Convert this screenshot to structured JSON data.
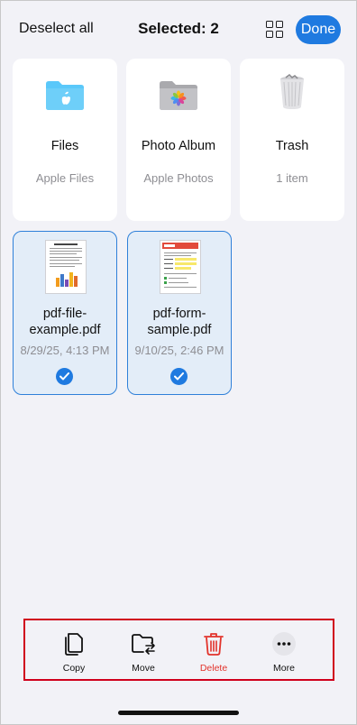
{
  "header": {
    "deselect_label": "Deselect all",
    "title": "Selected: 2",
    "grid_icon": "grid-icon",
    "done_label": "Done"
  },
  "colors": {
    "accent": "#1f7ae0",
    "selected_bg": "#e3edf8",
    "delete_red": "#e2332b",
    "highlight_box": "#d0001c"
  },
  "locations": [
    {
      "name": "Files",
      "subtitle": "Apple Files",
      "icon": "folder-icon"
    },
    {
      "name": "Photo Album",
      "subtitle": "Apple Photos",
      "icon": "photos-icon"
    },
    {
      "name": "Trash",
      "subtitle": "1 item",
      "icon": "trash-bin-icon"
    }
  ],
  "files": [
    {
      "name": "pdf-file-\nexample.pdf",
      "date": "8/29/25, 4:13 PM",
      "selected": true,
      "icon": "pdf-thumbnail-icon"
    },
    {
      "name": "pdf-form-\nsample.pdf",
      "date": "9/10/25, 2:46 PM",
      "selected": true,
      "icon": "pdf-thumbnail-icon"
    }
  ],
  "toolbar": {
    "copy_label": "Copy",
    "move_label": "Move",
    "delete_label": "Delete",
    "more_label": "More"
  }
}
